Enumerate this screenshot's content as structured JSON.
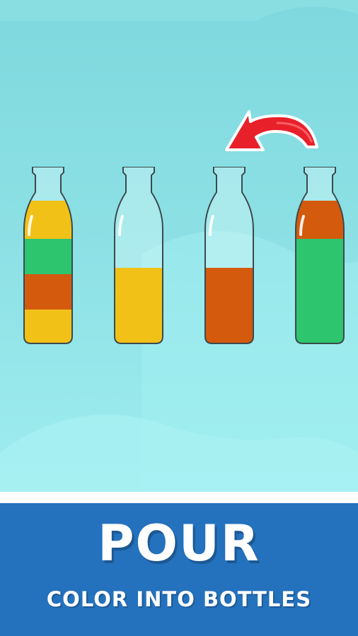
{
  "banner": {
    "title": "POUR",
    "subtitle": "COLOR INTO BOTTLES"
  },
  "colors": {
    "yellow": "#f2c118",
    "green": "#2dc56d",
    "orange": "#d45a0e",
    "background": "#8fe2e6",
    "banner": "#2471bd",
    "arrow": "#e8202a"
  },
  "bottles": [
    {
      "name": "bottle-1",
      "layers_top_to_bottom": [
        "yellow",
        "green",
        "orange",
        "yellow"
      ],
      "fill_fraction": 0.8
    },
    {
      "name": "bottle-2",
      "layers_top_to_bottom": [
        "yellow"
      ],
      "fill_fraction": 0.4
    },
    {
      "name": "bottle-3",
      "layers_top_to_bottom": [
        "orange"
      ],
      "fill_fraction": 0.4
    },
    {
      "name": "bottle-4",
      "layers_top_to_bottom": [
        "orange",
        "green"
      ],
      "fill_fraction": 0.8
    }
  ],
  "pour_arrow": {
    "icon": "curved-arrow-left-icon",
    "from": "bottle-4",
    "to": "bottle-3"
  }
}
